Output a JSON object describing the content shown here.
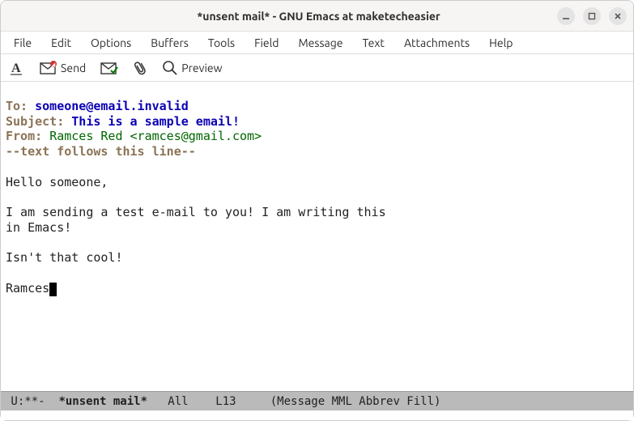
{
  "window": {
    "title": "*unsent mail* - GNU Emacs at maketecheasier"
  },
  "menubar": {
    "file": "File",
    "edit": "Edit",
    "options": "Options",
    "buffers": "Buffers",
    "tools": "Tools",
    "field": "Field",
    "message": "Message",
    "text": "Text",
    "attachments": "Attachments",
    "help": "Help"
  },
  "toolbar": {
    "send": "Send",
    "preview": "Preview"
  },
  "headers": {
    "to_label": "To:",
    "to_value": "someone@email.invalid",
    "subject_label": "Subject:",
    "subject_value": "This is a sample email!",
    "from_label": "From:",
    "from_value": "Ramces Red <ramces@gmail.com>",
    "separator": "--text follows this line--"
  },
  "body": {
    "l1": "Hello someone,",
    "l2": "I am sending a test e-mail to you! I am writing this",
    "l3": "in Emacs!",
    "l4": "Isn't that cool!",
    "l5": "Ramces"
  },
  "modeline": {
    "left": " U:**-  ",
    "buffer": "*unsent mail*",
    "pos": "   All    L13     ",
    "modes": "(Message MML Abbrev Fill)"
  }
}
